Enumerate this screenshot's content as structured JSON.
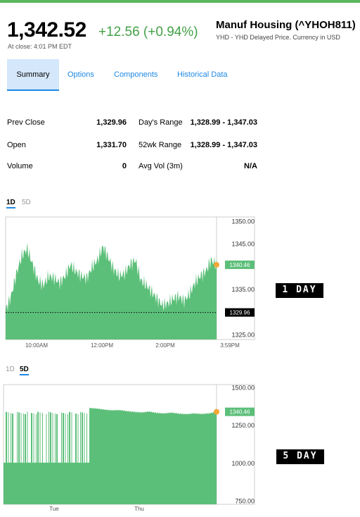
{
  "quote": {
    "price": "1,342.52",
    "change": "+12.56 (+0.94%)",
    "as_of": "At close: 4:01 PM EDT",
    "name": "Manuf Housing (^YHOH811)",
    "subtitle": "YHD - YHD Delayed Price. Currency in USD"
  },
  "tabs": [
    "Summary",
    "Options",
    "Components",
    "Historical Data"
  ],
  "stats": {
    "prev_close_label": "Prev Close",
    "prev_close": "1,329.96",
    "open_label": "Open",
    "open": "1,331.70",
    "volume_label": "Volume",
    "volume": "0",
    "days_range_label": "Day's Range",
    "days_range": "1,328.99 - 1,347.03",
    "wk52_label": "52wk Range",
    "wk52": "1,328.99 - 1,347.03",
    "avgvol_label": "Avg Vol (3m)",
    "avgvol": "N/A"
  },
  "chart1": {
    "period_tabs": [
      "1D",
      "5D"
    ],
    "active": "1D",
    "side_label": "1 DAY"
  },
  "chart2": {
    "period_tabs": [
      "1D",
      "5D"
    ],
    "active": "5D",
    "side_label": "5 DAY"
  },
  "colors": {
    "up": "#43a047",
    "fill": "#5cbf79",
    "accent": "#1e88e5",
    "marker": "#f4a636"
  },
  "chart_data": [
    {
      "type": "area",
      "title": "",
      "x": [
        "9:30",
        "9:40",
        "9:50",
        "10:00",
        "10:10",
        "10:20",
        "10:30",
        "10:40",
        "10:50",
        "11:00",
        "11:10",
        "11:20",
        "11:30",
        "11:40",
        "11:50",
        "12:00",
        "12:10",
        "12:20",
        "12:30",
        "12:40",
        "12:50",
        "13:00",
        "13:10",
        "13:20",
        "13:30",
        "13:40",
        "13:50",
        "14:00",
        "14:10",
        "14:20",
        "14:30",
        "14:40",
        "14:50",
        "15:00",
        "15:10",
        "15:20",
        "15:30",
        "15:40",
        "15:50",
        "15:59"
      ],
      "values": [
        1330.5,
        1333.5,
        1338.5,
        1342.5,
        1344.0,
        1340.5,
        1337.0,
        1336.0,
        1338.0,
        1337.5,
        1336.5,
        1338.0,
        1340.5,
        1339.0,
        1338.0,
        1337.5,
        1340.0,
        1341.5,
        1344.5,
        1342.0,
        1339.5,
        1338.0,
        1338.5,
        1340.5,
        1341.5,
        1337.0,
        1336.0,
        1334.5,
        1333.0,
        1331.5,
        1332.0,
        1333.0,
        1333.5,
        1332.5,
        1334.0,
        1336.5,
        1338.0,
        1339.0,
        1341.5,
        1340.46
      ],
      "x_ticks": [
        "10:00AM",
        "12:00PM",
        "2:00PM",
        "3:59PM"
      ],
      "y_ticks": [
        "1350.00",
        "1345.00",
        "1335.00",
        "1330.00",
        "1325.00"
      ],
      "ylim": [
        1324.0,
        1351.0
      ],
      "last_label": "1340.46",
      "prev_close_label": "1329.96",
      "prev_close": 1329.96
    },
    {
      "type": "area",
      "title": "",
      "x_ticks": [
        "Tue",
        "Thu"
      ],
      "y_ticks": [
        "1500.00",
        "1250.00",
        "1000.00",
        "750.00"
      ],
      "ylim": [
        730,
        1520
      ],
      "low_segment_value": 1005,
      "high_segment_values": [
        1365,
        1362,
        1355,
        1350,
        1352,
        1345,
        1340,
        1336,
        1342,
        1333,
        1330,
        1335,
        1328,
        1325,
        1330,
        1326,
        1330,
        1340.46
      ],
      "last_label": "1340.46"
    }
  ]
}
